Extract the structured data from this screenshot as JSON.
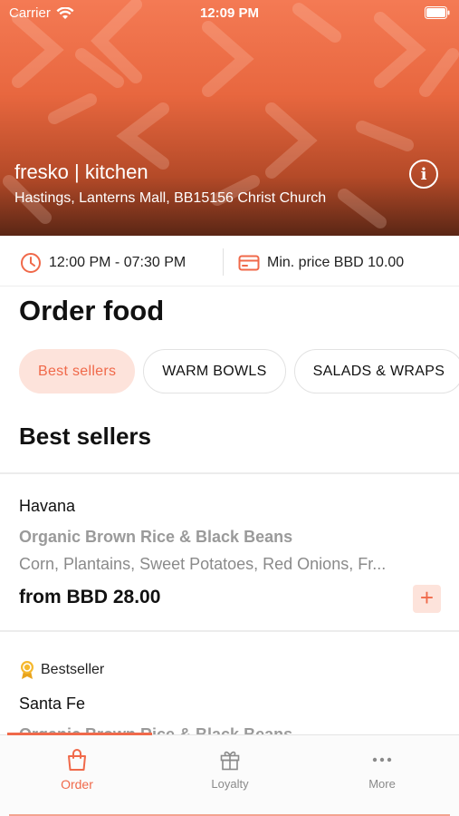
{
  "status_bar": {
    "carrier": "Carrier",
    "time": "12:09 PM"
  },
  "store": {
    "name": "fresko | kitchen",
    "address": "Hastings, Lanterns Mall, BB15156 Christ Church",
    "info_symbol": "i"
  },
  "info": {
    "hours": "12:00 PM - 07:30 PM",
    "min_price": "Min. price BBD 10.00"
  },
  "page_title": "Order food",
  "categories": [
    {
      "label": "Best sellers",
      "active": true
    },
    {
      "label": "WARM BOWLS",
      "active": false
    },
    {
      "label": "SALADS & WRAPS",
      "active": false
    }
  ],
  "section_title": "Best sellers",
  "products": [
    {
      "name": "Havana",
      "subtitle": "Organic Brown Rice & Black Beans",
      "description": "Corn, Plantains, Sweet Potatoes, Red Onions, Fr...",
      "price": "from BBD 28.00",
      "add_symbol": "+"
    },
    {
      "badge": "Bestseller",
      "name": "Santa Fe",
      "subtitle": "Organic Brown Rice & Black Beans"
    }
  ],
  "tabs": [
    {
      "label": "Order",
      "icon": "shopping-bag-icon",
      "active": true
    },
    {
      "label": "Loyalty",
      "icon": "gift-icon",
      "active": false
    },
    {
      "label": "More",
      "icon": "more-dots-icon",
      "active": false
    }
  ],
  "colors": {
    "accent": "#f0694a",
    "accent_light": "#fde3db",
    "hero_top": "#f47a54",
    "hero_bottom": "#5a2615"
  }
}
